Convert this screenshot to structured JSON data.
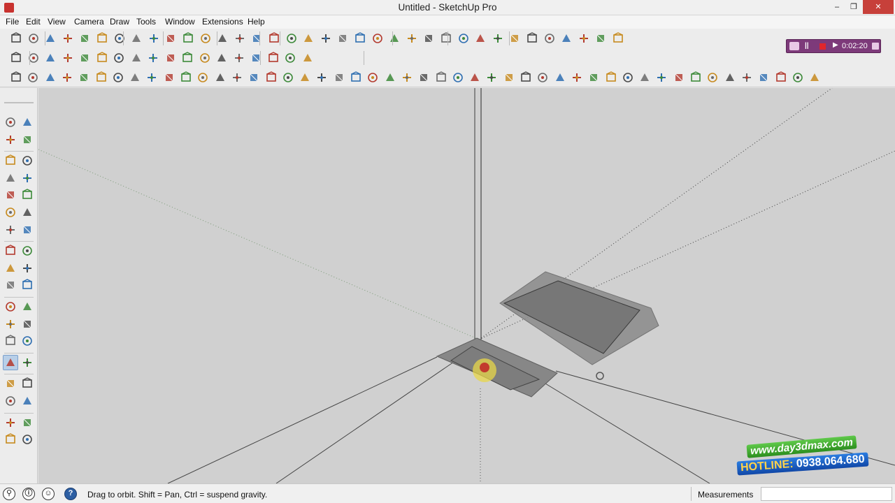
{
  "window": {
    "title": "Untitled - SketchUp Pro",
    "controls": {
      "minimize": "‒",
      "maximize": "❐",
      "close": "✕"
    }
  },
  "menu": [
    "File",
    "Edit",
    "View",
    "Camera",
    "Draw",
    "Tools",
    "Window",
    "Extensions",
    "Help"
  ],
  "toolbar_row1": [
    "new-file-icon",
    "open-file-icon",
    "save-icon",
    "cut-icon",
    "copy-icon",
    "paste-icon",
    "text-icon",
    "3d-text-icon",
    "undo-icon",
    "redo-icon",
    "print-icon",
    "model-info-icon",
    "layers-icon",
    "styles-icon",
    "scenes-icon",
    "iso-view-icon",
    "top-view-icon",
    "front-view-icon",
    "right-view-icon",
    "back-view-icon",
    "left-view-icon",
    "section-plane-icon",
    "section-cut-icon",
    "section-fill-icon",
    "xray-icon",
    "hidden-line-icon",
    "shaded-icon",
    "textured-icon",
    "monochrome-icon",
    "wireframe-icon",
    "component-browser-icon",
    "warehouse-icon",
    "sandbox-icon",
    "extension-icon",
    "extension-manager-icon",
    "delete-icon"
  ],
  "toolbar_row2": [
    "solid-tools-icon",
    "outer-shell-icon",
    "intersect-icon",
    "union-icon",
    "subtract-icon",
    "trim-icon",
    "split-icon",
    "sun-icon",
    "shadow-icon",
    "fog-icon",
    "photo-match-icon",
    "edge-style-icon",
    "axes-icon",
    "point-icon",
    "guide-icon",
    "dimension-icon",
    "protractor-icon",
    "tape-icon"
  ],
  "toolbar_row3_count": 48,
  "recorder": {
    "time": "0:02:20",
    "pause": "||",
    "play": "▶"
  },
  "left_tools": [
    [
      "select-icon",
      "component-icon"
    ],
    [
      "paint-bucket-icon",
      "eraser-icon"
    ],
    [
      "line-icon",
      "freehand-icon"
    ],
    [
      "rectangle-icon",
      "rotated-rectangle-icon"
    ],
    [
      "circle-icon",
      "polygon-icon"
    ],
    [
      "arc-icon",
      "two-point-arc-icon"
    ],
    [
      "pie-icon",
      "three-point-arc-icon"
    ],
    [
      "move-icon",
      "push-pull-icon"
    ],
    [
      "rotate-icon",
      "follow-me-icon"
    ],
    [
      "scale-icon",
      "offset-icon"
    ],
    [
      "tape-measure-icon",
      "dimensions-icon"
    ],
    [
      "protractor-icon",
      "text-label-icon"
    ],
    [
      "axes-icon",
      "3d-text-icon"
    ],
    [
      "orbit-icon",
      "pan-icon"
    ],
    [
      "zoom-icon",
      "zoom-window-icon"
    ],
    [
      "zoom-extents-icon",
      "previous-view-icon"
    ],
    [
      "position-camera-icon",
      "look-around-icon"
    ],
    [
      "walk-icon",
      "section-plane-icon"
    ]
  ],
  "statusbar": {
    "icons": [
      "geo-location-icon",
      "credits-icon",
      "user-icon",
      "help-icon"
    ],
    "icon_glyphs": [
      "⚲",
      "ⓘ",
      "☺",
      "?"
    ],
    "text": "Drag to orbit. Shift = Pan, Ctrl = suspend gravity.",
    "measurements_label": "Measurements",
    "measurements_value": ""
  },
  "watermark": {
    "url": "www.day3dmax.com",
    "hotline_label": "HOTLINE:",
    "hotline_number": "0938.064.680"
  }
}
